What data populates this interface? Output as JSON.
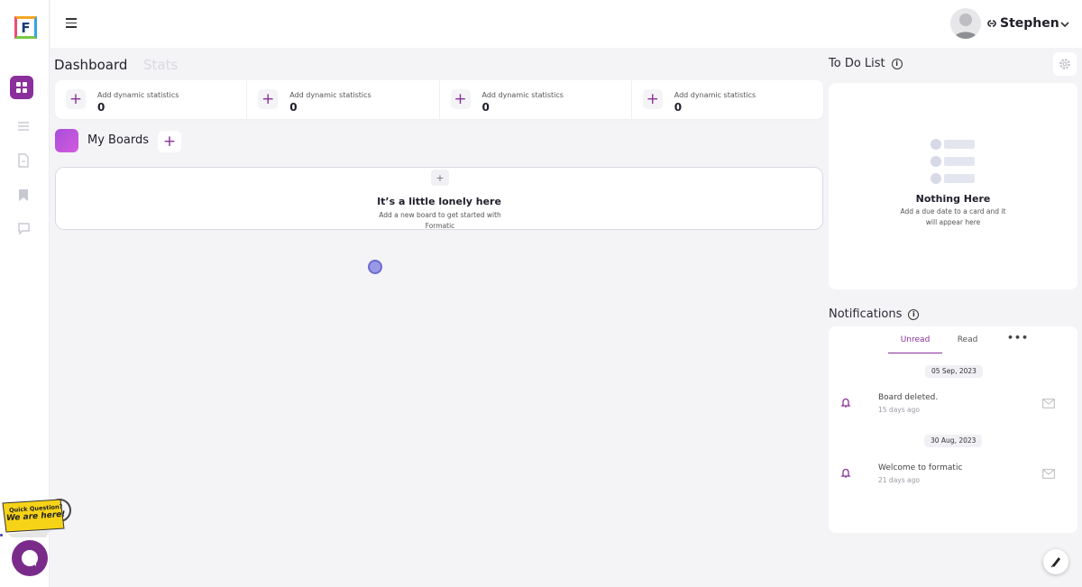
{
  "header": {
    "user_name": "Stephen"
  },
  "tabs": [
    {
      "label": "Dashboard"
    },
    {
      "label": "Stats"
    }
  ],
  "stats": [
    {
      "label": "Add dynamic statistics",
      "value": "0"
    },
    {
      "label": "Add dynamic statistics",
      "value": "0"
    },
    {
      "label": "Add dynamic statistics",
      "value": "0"
    },
    {
      "label": "Add dynamic statistics",
      "value": "0"
    }
  ],
  "boards": {
    "title": "My Boards",
    "empty_title": "It’s a little lonely here",
    "empty_sub": "Add a new board to get started with Formatic"
  },
  "todo": {
    "title": "To Do List",
    "empty_title": "Nothing Here",
    "empty_sub": "Add a due date to a card and it will appear here"
  },
  "notifications": {
    "title": "Notifications",
    "tabs": [
      {
        "label": "Unread"
      },
      {
        "label": "Read"
      }
    ],
    "more": "•••",
    "groups": [
      {
        "date": "05 Sep, 2023",
        "message": "Board deleted.",
        "time": "15 days ago"
      },
      {
        "date": "30 Aug, 2023",
        "message": "Welcome to formatic",
        "time": "21 days ago"
      }
    ]
  },
  "helper": {
    "line1": "Quick Question?",
    "line2": "We are here!"
  },
  "logo_letter": "F",
  "colors": {
    "accent": "#8b2f9b",
    "background": "#f4f4f7"
  }
}
